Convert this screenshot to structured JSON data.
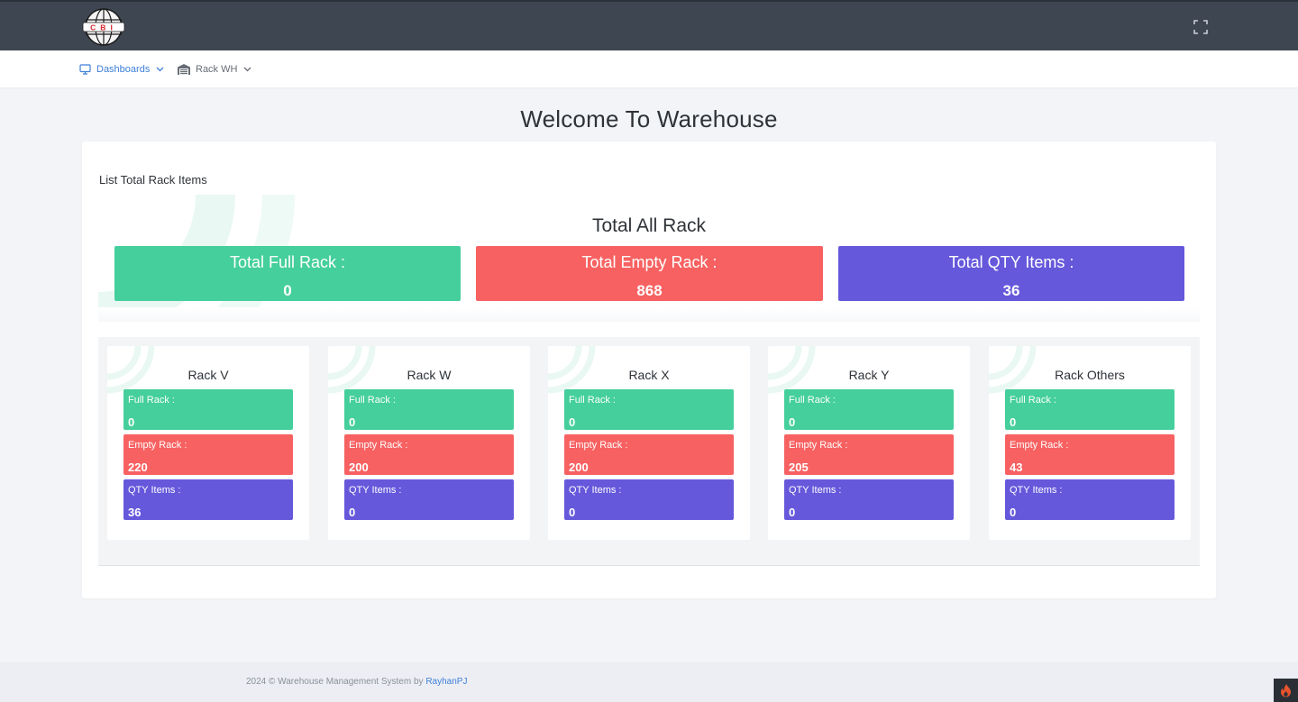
{
  "logo_text": "CBI",
  "header": {
    "fullscreen_icon": "fullscreen-icon"
  },
  "nav": {
    "items": [
      {
        "label": "Dashboards",
        "icon": "monitor-icon",
        "active": true
      },
      {
        "label": "Rack WH",
        "icon": "warehouse-icon",
        "active": false
      }
    ]
  },
  "page": {
    "title": "Welcome To Warehouse"
  },
  "card": {
    "heading": "List Total Rack Items",
    "total_title": "Total All Rack",
    "stats": [
      {
        "label": "Total Full Rack :",
        "value": "0",
        "color": "#45cf9c"
      },
      {
        "label": "Total Empty Rack :",
        "value": "868",
        "color": "#f76161"
      },
      {
        "label": "Total QTY Items :",
        "value": "36",
        "color": "#6558db"
      }
    ]
  },
  "racks": [
    {
      "name": "Rack V",
      "full_label": "Full Rack :",
      "full": "0",
      "empty_label": "Empty Rack :",
      "empty": "220",
      "qty_label": "QTY Items :",
      "qty": "36"
    },
    {
      "name": "Rack W",
      "full_label": "Full Rack :",
      "full": "0",
      "empty_label": "Empty Rack :",
      "empty": "200",
      "qty_label": "QTY Items :",
      "qty": "0"
    },
    {
      "name": "Rack X",
      "full_label": "Full Rack :",
      "full": "0",
      "empty_label": "Empty Rack :",
      "empty": "200",
      "qty_label": "QTY Items :",
      "qty": "0"
    },
    {
      "name": "Rack Y",
      "full_label": "Full Rack :",
      "full": "0",
      "empty_label": "Empty Rack :",
      "empty": "205",
      "qty_label": "QTY Items :",
      "qty": "0"
    },
    {
      "name": "Rack Others",
      "full_label": "Full Rack :",
      "full": "0",
      "empty_label": "Empty Rack :",
      "empty": "43",
      "qty_label": "QTY Items :",
      "qty": "0"
    }
  ],
  "footer": {
    "text": "2024 © Warehouse Management System by",
    "link": "RayhanPJ"
  },
  "colors": {
    "topbar": "#3e4651",
    "accent": "#3d7fd8",
    "full": "#45cf9c",
    "empty": "#f76161",
    "qty": "#6558db"
  }
}
